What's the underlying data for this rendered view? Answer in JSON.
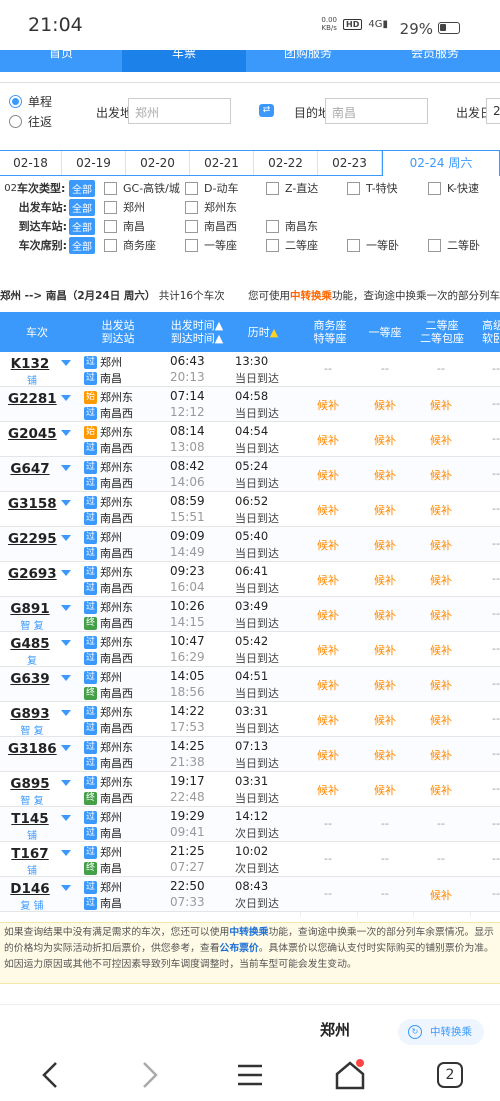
{
  "status": {
    "time": "21:04",
    "net_speed": "0.00",
    "net_unit": "KB/s",
    "hd": "HD",
    "signal": "4G",
    "battery": "29%"
  },
  "nav": [
    "首页",
    "车票",
    "团购服务",
    "会员服务"
  ],
  "trip": {
    "oneway": "单程",
    "roundtrip": "往返",
    "from_label": "出发地",
    "from_value": "郑州",
    "to_label": "目的地",
    "to_value": "南昌",
    "date_label": "出发日",
    "date_value": "2"
  },
  "dates": [
    "02-18",
    "02-19",
    "02-20",
    "02-21",
    "02-22",
    "02-23",
    "02-24 周六"
  ],
  "filters": {
    "type_label": "车次类型:",
    "type_prefix": "02",
    "all": "全部",
    "types": [
      "GC-高铁/城",
      "D-动车",
      "Z-直达",
      "T-特快",
      "K-快速"
    ],
    "from_label": "出发车站:",
    "from_st": [
      "郑州",
      "郑州东"
    ],
    "to_label": "到达车站:",
    "to_st": [
      "南昌",
      "南昌西",
      "南昌东"
    ],
    "seat_label": "车次席别:",
    "seats": [
      "商务座",
      "一等座",
      "二等座",
      "一等卧",
      "二等卧"
    ]
  },
  "summary": {
    "route": "郑州 --> 南昌（2月24日  周六）",
    "count": "共计16个车次",
    "tip1": "您可使用",
    "tip_link": "中转换乘",
    "tip2": "功能，查询途中换乘一次的部分列车余票"
  },
  "thead": {
    "train": "车次",
    "st1": "出发站",
    "st2": "到达站",
    "t1": "出发时间",
    "t2": "到达时间",
    "dur": "历时",
    "c1a": "商务座",
    "c1b": "特等座",
    "c2": "一等座",
    "c3a": "二等座",
    "c3b": "二等包座",
    "c4a": "高级",
    "c4b": "软卧"
  },
  "trains": [
    {
      "no": "K132",
      "tags": "铺",
      "dep_tag": "过",
      "dep": "郑州",
      "arr_tag": "过",
      "arr": "南昌",
      "t1": "06:43",
      "t2": "20:13",
      "dur": "13:30",
      "day": "当日到达",
      "c": [
        "--",
        "--",
        "--",
        "--"
      ]
    },
    {
      "no": "G2281",
      "tags": "",
      "dep_tag": "始",
      "dep": "郑州东",
      "arr_tag": "过",
      "arr": "南昌西",
      "t1": "07:14",
      "t2": "12:12",
      "dur": "04:58",
      "day": "当日到达",
      "c": [
        "候补",
        "候补",
        "候补",
        "--"
      ]
    },
    {
      "no": "G2045",
      "tags": "",
      "dep_tag": "始",
      "dep": "郑州东",
      "arr_tag": "过",
      "arr": "南昌西",
      "t1": "08:14",
      "t2": "13:08",
      "dur": "04:54",
      "day": "当日到达",
      "c": [
        "候补",
        "候补",
        "候补",
        "--"
      ]
    },
    {
      "no": "G647",
      "tags": "",
      "dep_tag": "过",
      "dep": "郑州东",
      "arr_tag": "过",
      "arr": "南昌西",
      "t1": "08:42",
      "t2": "14:06",
      "dur": "05:24",
      "day": "当日到达",
      "c": [
        "候补",
        "候补",
        "候补",
        "--"
      ]
    },
    {
      "no": "G3158",
      "tags": "",
      "dep_tag": "过",
      "dep": "郑州东",
      "arr_tag": "过",
      "arr": "南昌西",
      "t1": "08:59",
      "t2": "15:51",
      "dur": "06:52",
      "day": "当日到达",
      "c": [
        "候补",
        "候补",
        "候补",
        "--"
      ]
    },
    {
      "no": "G2295",
      "tags": "",
      "dep_tag": "过",
      "dep": "郑州",
      "arr_tag": "过",
      "arr": "南昌西",
      "t1": "09:09",
      "t2": "14:49",
      "dur": "05:40",
      "day": "当日到达",
      "c": [
        "候补",
        "候补",
        "候补",
        "--"
      ]
    },
    {
      "no": "G2693",
      "tags": "",
      "dep_tag": "过",
      "dep": "郑州东",
      "arr_tag": "过",
      "arr": "南昌西",
      "t1": "09:23",
      "t2": "16:04",
      "dur": "06:41",
      "day": "当日到达",
      "c": [
        "候补",
        "候补",
        "候补",
        "--"
      ]
    },
    {
      "no": "G891",
      "tags": "智 复",
      "dep_tag": "过",
      "dep": "郑州东",
      "arr_tag": "终",
      "arr": "南昌西",
      "t1": "10:26",
      "t2": "14:15",
      "dur": "03:49",
      "day": "当日到达",
      "c": [
        "候补",
        "候补",
        "候补",
        "--"
      ]
    },
    {
      "no": "G485",
      "tags": "复",
      "dep_tag": "过",
      "dep": "郑州东",
      "arr_tag": "过",
      "arr": "南昌西",
      "t1": "10:47",
      "t2": "16:29",
      "dur": "05:42",
      "day": "当日到达",
      "c": [
        "候补",
        "候补",
        "候补",
        "--"
      ]
    },
    {
      "no": "G639",
      "tags": "",
      "dep_tag": "过",
      "dep": "郑州",
      "arr_tag": "终",
      "arr": "南昌西",
      "t1": "14:05",
      "t2": "18:56",
      "dur": "04:51",
      "day": "当日到达",
      "c": [
        "候补",
        "候补",
        "候补",
        "--"
      ]
    },
    {
      "no": "G893",
      "tags": "智 复",
      "dep_tag": "过",
      "dep": "郑州东",
      "arr_tag": "过",
      "arr": "南昌西",
      "t1": "14:22",
      "t2": "17:53",
      "dur": "03:31",
      "day": "当日到达",
      "c": [
        "候补",
        "候补",
        "候补",
        "--"
      ]
    },
    {
      "no": "G3186",
      "tags": "",
      "dep_tag": "过",
      "dep": "郑州东",
      "arr_tag": "过",
      "arr": "南昌西",
      "t1": "14:25",
      "t2": "21:38",
      "dur": "07:13",
      "day": "当日到达",
      "c": [
        "候补",
        "候补",
        "候补",
        "--"
      ]
    },
    {
      "no": "G895",
      "tags": "智 复",
      "dep_tag": "过",
      "dep": "郑州东",
      "arr_tag": "终",
      "arr": "南昌西",
      "t1": "19:17",
      "t2": "22:48",
      "dur": "03:31",
      "day": "当日到达",
      "c": [
        "候补",
        "候补",
        "候补",
        "--"
      ]
    },
    {
      "no": "T145",
      "tags": "铺",
      "dep_tag": "过",
      "dep": "郑州",
      "arr_tag": "过",
      "arr": "南昌",
      "t1": "19:29",
      "t2": "09:41",
      "dur": "14:12",
      "day": "次日到达",
      "c": [
        "--",
        "--",
        "--",
        "--"
      ]
    },
    {
      "no": "T167",
      "tags": "铺",
      "dep_tag": "过",
      "dep": "郑州",
      "arr_tag": "终",
      "arr": "南昌",
      "t1": "21:25",
      "t2": "07:27",
      "dur": "10:02",
      "day": "次日到达",
      "c": [
        "--",
        "--",
        "--",
        "--"
      ]
    },
    {
      "no": "D146",
      "tags": "复 铺",
      "dep_tag": "过",
      "dep": "郑州",
      "arr_tag": "过",
      "arr": "南昌",
      "t1": "22:50",
      "t2": "07:33",
      "dur": "08:43",
      "day": "次日到达",
      "c": [
        "--",
        "--",
        "候补",
        "--"
      ]
    }
  ],
  "notice": {
    "a": "如果查询结果中没有满足需求的车次，您还可以使用",
    "link1": "中转换乘",
    "b": "功能，查询途中换乘一次的部分列车余票情况。显示的价格均为实际活动折扣后票价，供您参考，查看",
    "link2": "公布票价",
    "c": "。具体票价以您确认支付时实际购买的铺别票价为准。如因运力原因或其他不可控因素导致列车调度调整时，当前车型可能会发生变动。"
  },
  "footer": {
    "city": "郑州",
    "transfer": "中转换乘"
  },
  "bottom": {
    "tabs": "2"
  }
}
